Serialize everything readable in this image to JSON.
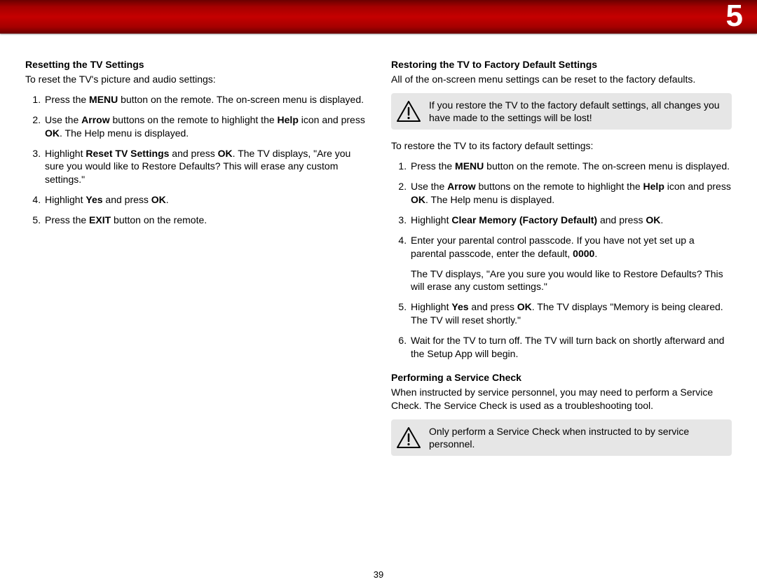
{
  "chapter": "5",
  "page_number": "39",
  "left": {
    "title": "Resetting the TV Settings",
    "intro": "To reset the TV's picture and audio settings:",
    "steps": [
      {
        "pre": "Press the ",
        "b1": "MENU",
        "post1": " button on the remote. The on-screen menu is displayed."
      },
      {
        "pre": "Use the ",
        "b1": "Arrow",
        "mid": " buttons on the remote to highlight the ",
        "b2": "Help",
        "post1": " icon and press ",
        "b3": "OK",
        "post2": ". The Help menu is displayed."
      },
      {
        "pre": "Highlight ",
        "b1": "Reset TV Settings",
        "mid": " and press ",
        "b2": "OK",
        "post1": ". The TV displays, \"Are you sure you would like to Restore Defaults? This will erase any custom settings.\""
      },
      {
        "pre": "Highlight ",
        "b1": "Yes",
        "mid": " and press ",
        "b2": "OK",
        "post1": "."
      },
      {
        "pre": "Press the ",
        "b1": "EXIT",
        "post1": " button on the remote."
      }
    ]
  },
  "right": {
    "title1": "Restoring the TV to Factory Default Settings",
    "intro1": "All of the on-screen menu settings can be reset to the factory defaults.",
    "warning1": "If you restore the TV to the factory default settings, all changes you have made to the settings will be lost!",
    "intro2": "To restore the TV to its factory default settings:",
    "steps": [
      {
        "pre": "Press the ",
        "b1": "MENU",
        "post1": " button on the remote. The on-screen menu is displayed."
      },
      {
        "pre": "Use the ",
        "b1": "Arrow",
        "mid": " buttons on the remote to highlight the ",
        "b2": "Help",
        "post1": " icon and press ",
        "b3": "OK",
        "post2": ". The Help menu is displayed."
      },
      {
        "pre": "Highlight ",
        "b1": "Clear Memory (Factory Default)",
        "mid": " and press ",
        "b2": "OK",
        "post1": "."
      },
      {
        "pre": "Enter your parental control passcode. If you have not yet set up a parental passcode, enter the default, ",
        "b1": "0000",
        "post1": ".",
        "extra": "The TV displays, \"Are you sure you would like to Restore Defaults? This will erase any custom settings.\""
      },
      {
        "pre": "Highlight ",
        "b1": "Yes",
        "mid": " and press ",
        "b2": "OK",
        "post1": ". The TV displays \"Memory is being cleared. The TV will reset shortly.\""
      },
      {
        "pre": "Wait for the TV to turn off. The TV will turn back on shortly afterward and the Setup App will begin."
      }
    ],
    "title2": "Performing a Service Check",
    "intro3": "When instructed by service personnel, you may need to perform a Service Check. The Service Check is used as a troubleshooting tool.",
    "warning2": "Only perform a Service Check when instructed to by service personnel."
  }
}
